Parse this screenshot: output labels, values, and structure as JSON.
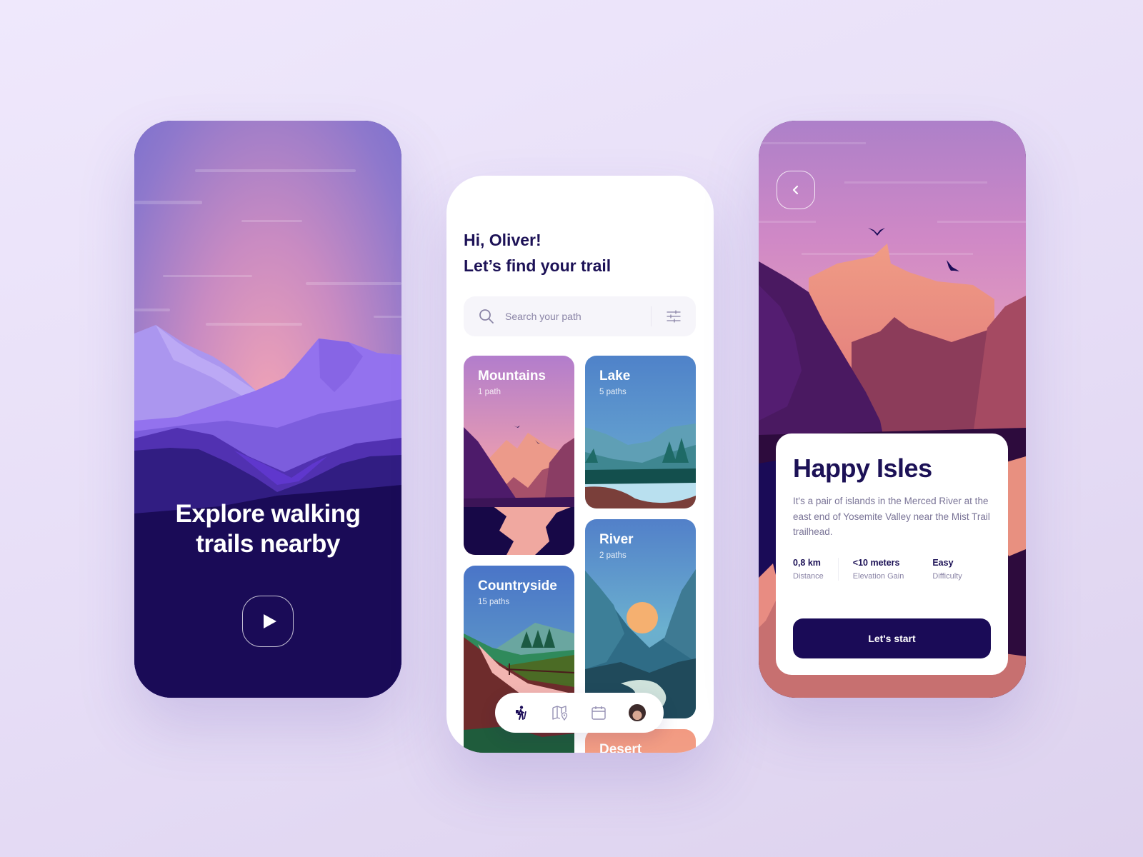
{
  "onboarding": {
    "title_line1": "Explore walking",
    "title_line2": "trails nearby",
    "play_icon": "play-icon"
  },
  "home": {
    "greeting_line1": "Hi, Oliver!",
    "greeting_line2": "Let’s find your trail",
    "search": {
      "placeholder": "Search your path",
      "value": "",
      "icon": "search-icon",
      "filter_icon": "sliders-icon"
    },
    "categories": [
      {
        "name": "Mountains",
        "count": "1 path"
      },
      {
        "name": "Lake",
        "count": "5 paths"
      },
      {
        "name": "River",
        "count": "2 paths"
      },
      {
        "name": "Countryside",
        "count": "15 paths"
      },
      {
        "name": "Desert",
        "count": ""
      }
    ],
    "bottom_nav": [
      {
        "icon": "hiker-icon",
        "active": true
      },
      {
        "icon": "map-pin-icon",
        "active": false
      },
      {
        "icon": "calendar-icon",
        "active": false
      },
      {
        "icon": "avatar",
        "active": false
      }
    ]
  },
  "detail": {
    "back_icon": "chevron-left-icon",
    "title": "Happy Isles",
    "description": "It's a pair of islands in the Merced River at the east end of Yosemite Valley near the Mist Trail trailhead.",
    "stats": [
      {
        "value": "0,8 km",
        "label": "Distance"
      },
      {
        "value": "<10 meters",
        "label": "Elevation Gain"
      },
      {
        "value": "Easy",
        "label": "Difficulty"
      }
    ],
    "cta_label": "Let's start"
  },
  "colors": {
    "primary": "#1a0b57",
    "heading": "#1c1156",
    "muted": "#8a84a6",
    "background": "#ece5fa"
  }
}
